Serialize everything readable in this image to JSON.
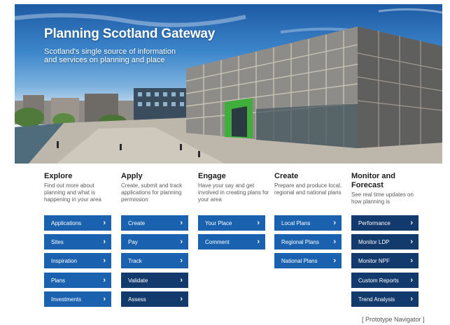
{
  "hero": {
    "title": "Planning Scotland Gateway",
    "subtitle": "Scotland's single source of information and services on planning and place"
  },
  "columns": [
    {
      "heading": "Explore",
      "description": "Find out more about planning and what is happening in your area",
      "buttons": [
        "Applications",
        "Sites",
        "Inspiration",
        "Plans",
        "Investments"
      ]
    },
    {
      "heading": "Apply",
      "description": "Create, submit and track applications for planning permission",
      "buttons": [
        "Create",
        "Pay",
        "Track",
        "Validate",
        "Assess"
      ]
    },
    {
      "heading": "Engage",
      "description": "Have your say and get involved in creating plans for your area",
      "buttons": [
        "Your Place",
        "Comment"
      ]
    },
    {
      "heading": "Create",
      "description": "Prepare and produce local, regional and national plans",
      "buttons": [
        "Local Plans",
        "Regional Plans",
        "National Plans"
      ]
    },
    {
      "heading": "Monitor and Forecast",
      "description": "See real time updates on how planning is",
      "buttons": [
        "Performance",
        "Monitor LDP",
        "Monitor NPF",
        "Custom Reports",
        "Trend Analysis"
      ]
    }
  ],
  "footer": {
    "note": "[ Prototype Navigator ]"
  },
  "colors": {
    "button": "#1a62b0",
    "button_dark": "#123a6d"
  },
  "icons": {
    "button_chevron": "chevron-right-icon"
  }
}
